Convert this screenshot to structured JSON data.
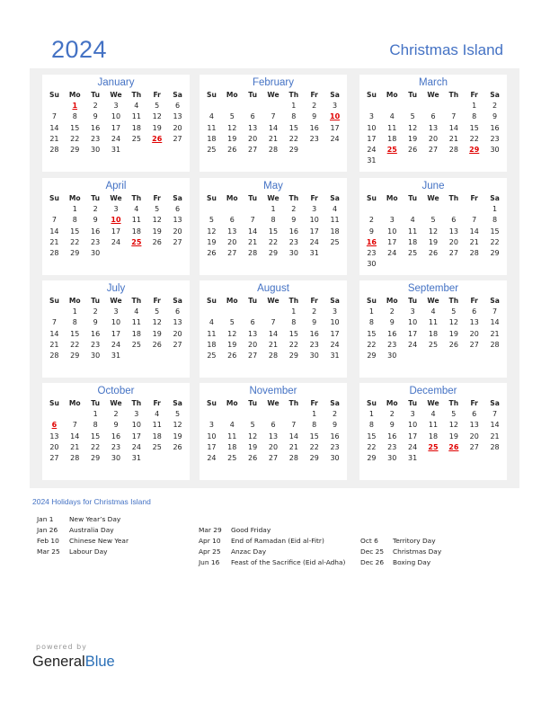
{
  "header": {
    "year": "2024",
    "country": "Christmas Island"
  },
  "weekdays": [
    "Su",
    "Mo",
    "Tu",
    "We",
    "Th",
    "Fr",
    "Sa"
  ],
  "colors": {
    "accent": "#4472c4",
    "holiday": "#e00000",
    "panel": "#f0f0f0"
  },
  "months": [
    {
      "name": "January",
      "start": 1,
      "days": 31,
      "holidays": [
        1,
        26
      ]
    },
    {
      "name": "February",
      "start": 4,
      "days": 29,
      "holidays": [
        10
      ]
    },
    {
      "name": "March",
      "start": 5,
      "days": 31,
      "holidays": [
        25,
        29
      ]
    },
    {
      "name": "April",
      "start": 1,
      "days": 30,
      "holidays": [
        10,
        25
      ]
    },
    {
      "name": "May",
      "start": 3,
      "days": 31,
      "holidays": []
    },
    {
      "name": "June",
      "start": 6,
      "days": 30,
      "holidays": [
        16
      ]
    },
    {
      "name": "July",
      "start": 1,
      "days": 31,
      "holidays": []
    },
    {
      "name": "August",
      "start": 4,
      "days": 31,
      "holidays": []
    },
    {
      "name": "September",
      "start": 0,
      "days": 30,
      "holidays": []
    },
    {
      "name": "October",
      "start": 2,
      "days": 31,
      "holidays": [
        6
      ]
    },
    {
      "name": "November",
      "start": 5,
      "days": 30,
      "holidays": []
    },
    {
      "name": "December",
      "start": 0,
      "days": 31,
      "holidays": [
        25,
        26
      ]
    }
  ],
  "holidays_section": {
    "title": "2024 Holidays for Christmas Island",
    "columns": [
      [
        {
          "date": "Jan 1",
          "name": "New Year’s Day"
        },
        {
          "date": "Jan 26",
          "name": "Australia Day"
        },
        {
          "date": "Feb 10",
          "name": "Chinese New Year"
        },
        {
          "date": "Mar 25",
          "name": "Labour Day"
        }
      ],
      [
        {
          "date": "Mar 29",
          "name": "Good Friday"
        },
        {
          "date": "Apr 10",
          "name": "End of Ramadan (Eid al-Fitr)"
        },
        {
          "date": "Apr 25",
          "name": "Anzac Day"
        },
        {
          "date": "Jun 16",
          "name": "Feast of the Sacrifice (Eid al-Adha)"
        }
      ],
      [
        {
          "date": "Oct 6",
          "name": "Territory Day"
        },
        {
          "date": "Dec 25",
          "name": "Christmas Day"
        },
        {
          "date": "Dec 26",
          "name": "Boxing Day"
        }
      ]
    ]
  },
  "footer": {
    "powered_by": "powered by",
    "brand_general": "General",
    "brand_blue": "Blue"
  }
}
